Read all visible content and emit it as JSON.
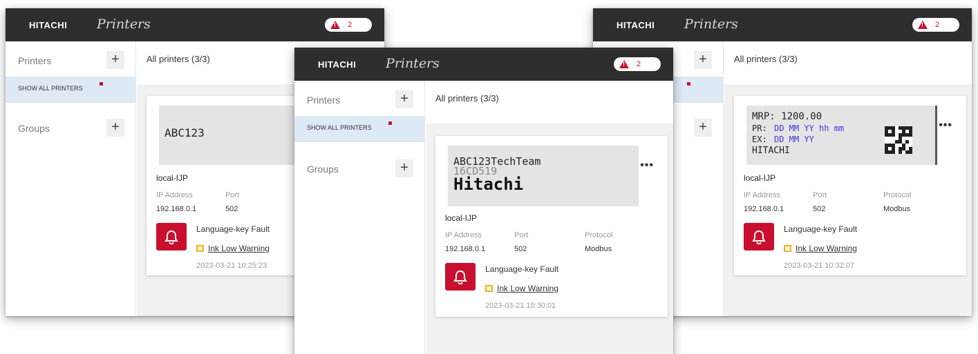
{
  "header": {
    "logo": "HITACHI",
    "title": "Printers",
    "alert_count": "2"
  },
  "sidebar": {
    "printers_label": "Printers",
    "add_symbol": "+",
    "show_all_label": "SHOW ALL PRINTERS",
    "groups_label": "Groups"
  },
  "main": {
    "title": "All printers (3/3)"
  },
  "card": {
    "name": "local-IJP",
    "ip_label": "IP Address",
    "ip": "192.168.0.1",
    "port_label": "Port",
    "port": "502",
    "protocol_label": "Protocol",
    "protocol": "Modbus",
    "fault": "Language-key Fault",
    "warning": "Ink Low Warning",
    "more": "•••"
  },
  "windows": {
    "left": {
      "label_text": "ABC123",
      "timestamp": "2023-03-21 10:25:23"
    },
    "mid": {
      "label_line1": "ABC123TechTeam",
      "label_line2": "16CD519",
      "label_line3": "Hitachi",
      "timestamp": "2023-03-21 10:30:01"
    },
    "right": {
      "l1": "MRP: 1200.00",
      "l2_prefix": "PR:",
      "l2_fields": "DD MM YY hh mm",
      "l3_prefix": "EX:",
      "l3_fields": "DD MM YY",
      "l4": "HITACHI",
      "timestamp": "2023-03-21 10:32:07"
    }
  },
  "colors": {
    "header_bg": "#2e2e2e",
    "accent_red": "#c8102e",
    "selected_bg": "#dde9f5",
    "field_blue": "#3a3adc",
    "warning_amber": "#f0b020"
  },
  "icons": {
    "alert": "warning-triangle-icon",
    "add": "plus-icon",
    "bell": "bell-icon",
    "ink": "ink-bottle-icon",
    "more": "more-horizontal-icon",
    "qr": "qr-code-icon"
  }
}
